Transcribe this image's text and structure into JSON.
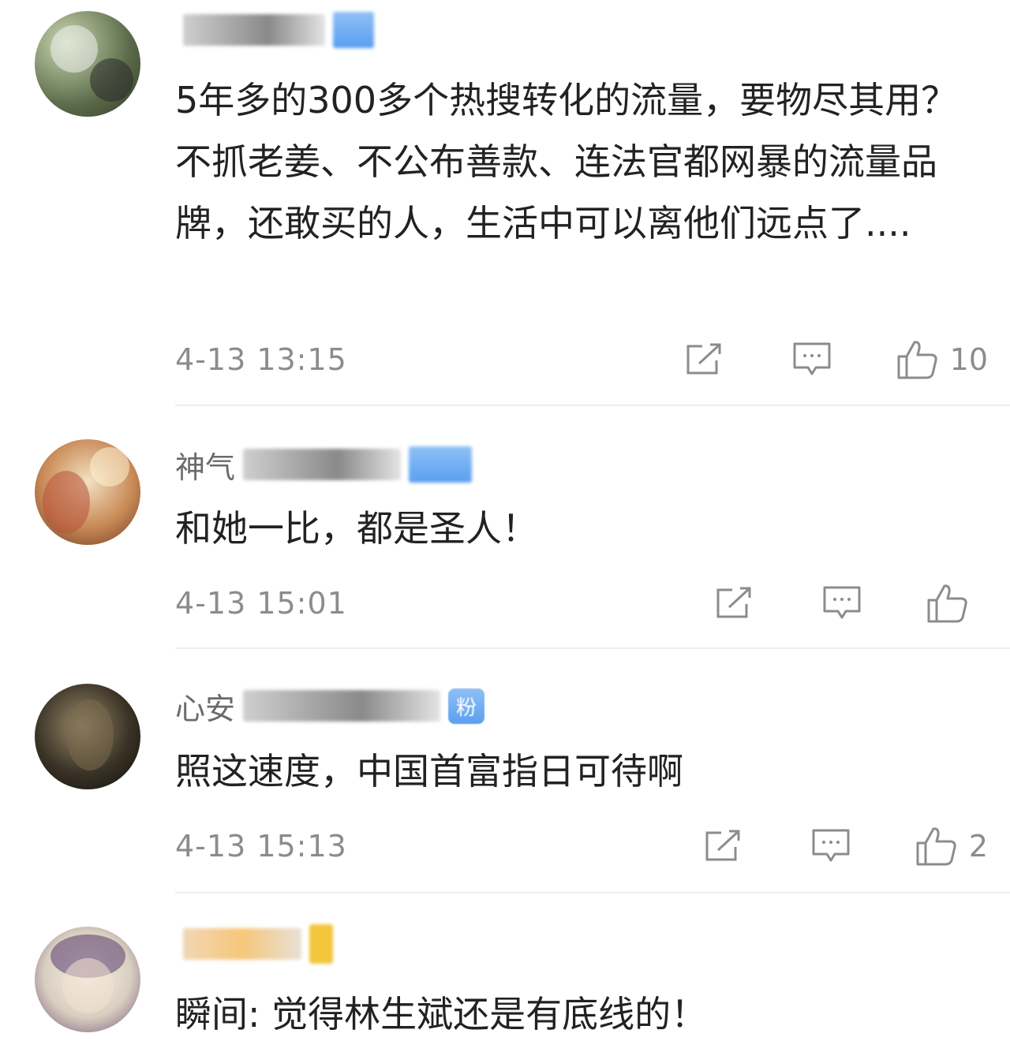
{
  "comments": [
    {
      "username": "",
      "text": "5年多的300多个热搜转化的流量，要物尽其用？不抓老姜、不公布善款、连法官都网暴的流量品牌，还敢买的人，生活中可以离他们远点了....",
      "time": "4-13 13:15",
      "likes": "10",
      "icons": [
        "share-icon",
        "comment-icon",
        "thumbs-up-icon"
      ]
    },
    {
      "username": "神气",
      "text": "和她一比，都是圣人！",
      "time": "4-13 15:01",
      "likes": "",
      "icons": [
        "share-icon",
        "comment-icon",
        "thumbs-up-icon"
      ]
    },
    {
      "username": "心安",
      "badge": "粉",
      "text": "照这速度，中国首富指日可待啊",
      "time": "4-13 15:13",
      "likes": "2",
      "icons": [
        "share-icon",
        "comment-icon",
        "thumbs-up-icon"
      ]
    },
    {
      "username": "",
      "text": "瞬间: 觉得林生斌还是有底线的！"
    }
  ],
  "colors": {
    "text": "#222222",
    "meta": "#8c8c8c",
    "username": "#6b6b6b",
    "badge": "#5a9ff0",
    "divider": "#eeeeee"
  }
}
